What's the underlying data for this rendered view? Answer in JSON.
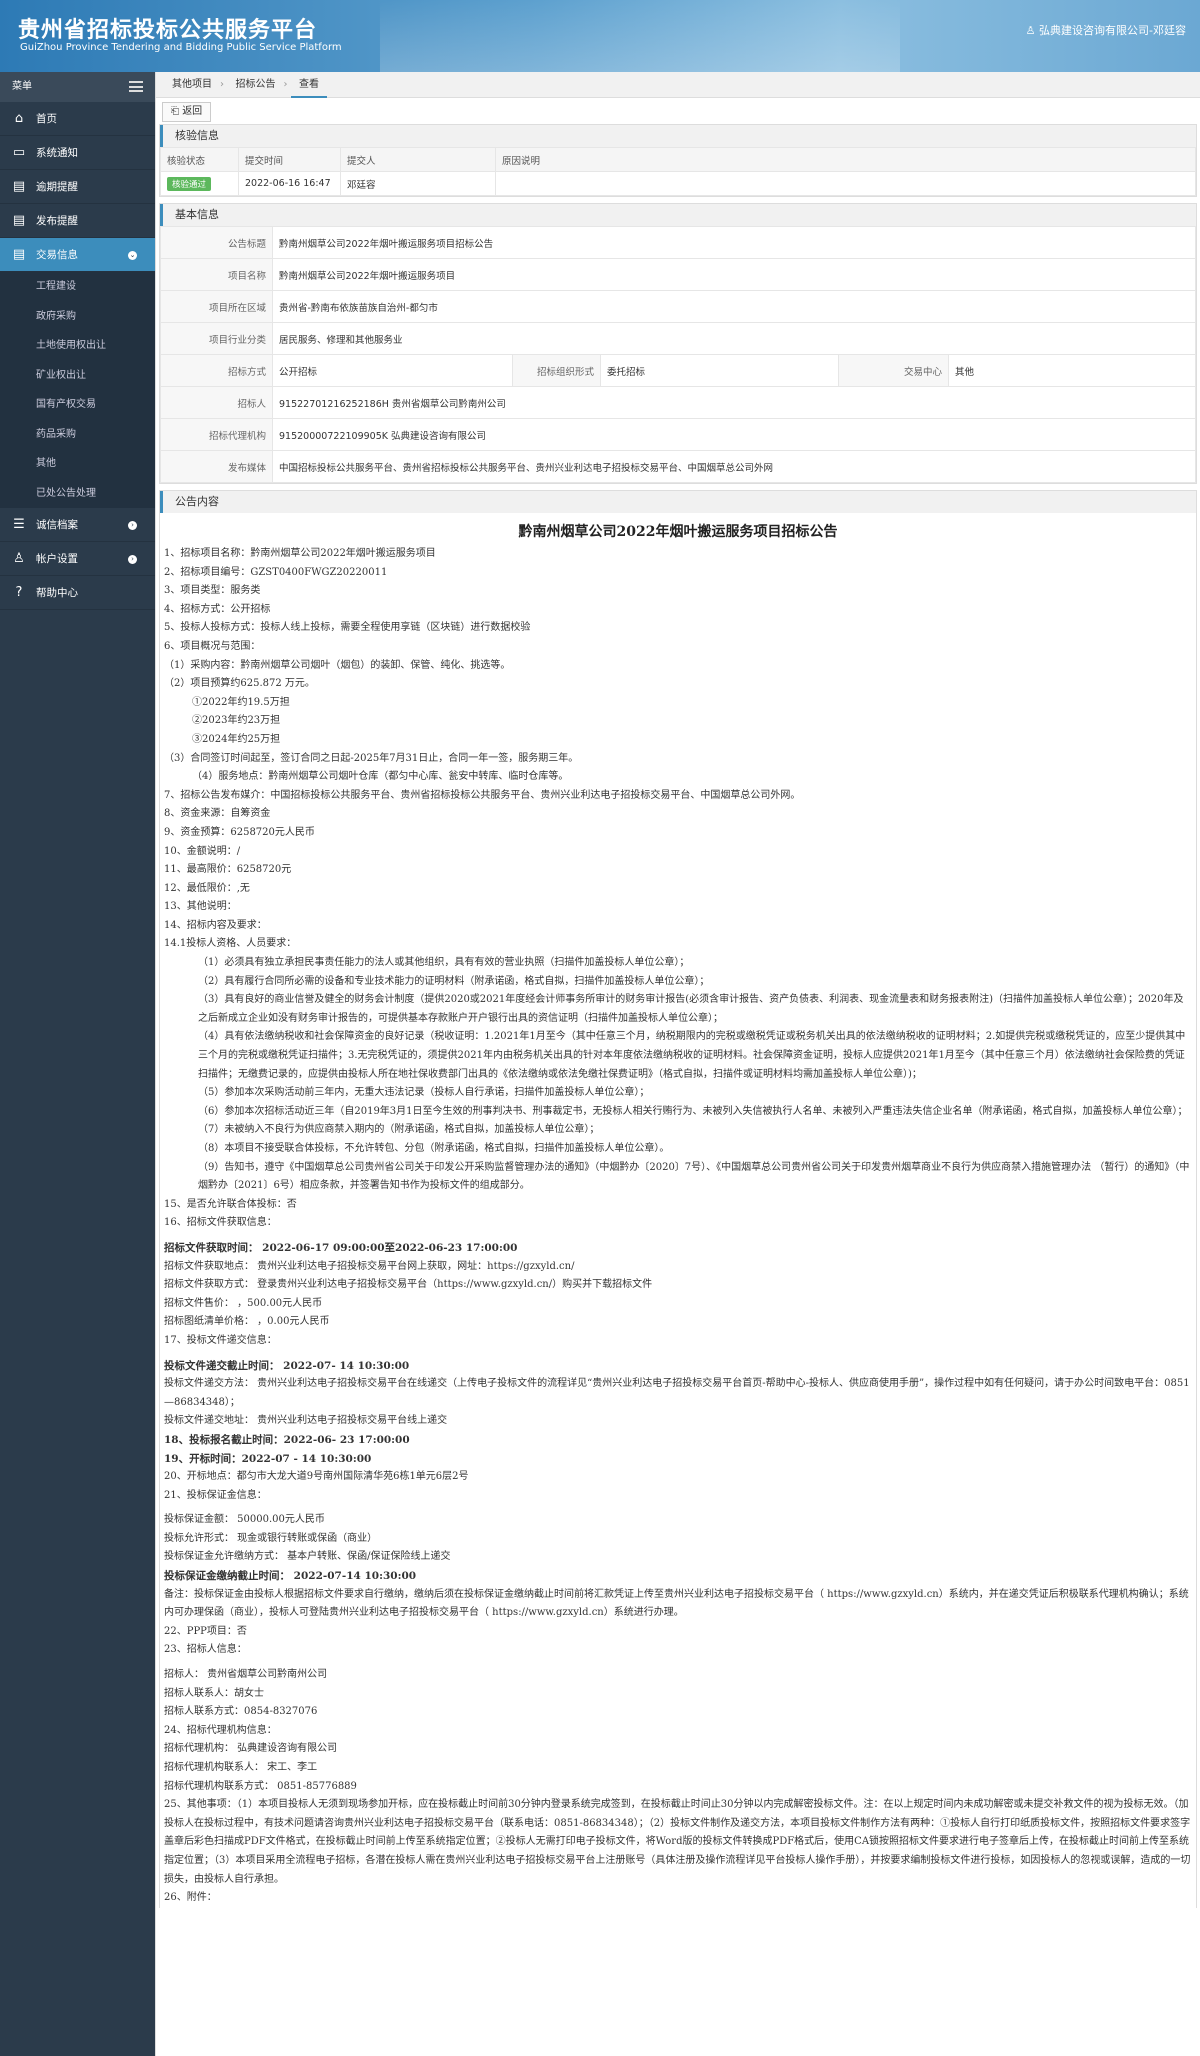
{
  "header": {
    "title": "贵州省招标投标公共服务平台",
    "subtitle": "GuiZhou Province Tendering and Bidding Public Service Platform",
    "user": "弘典建设咨询有限公司-邓廷容"
  },
  "sidebar": {
    "menu_label": "菜单",
    "items": [
      {
        "icon": "home-icon",
        "glyph": "⌂",
        "label": "首页"
      },
      {
        "icon": "monitor-icon",
        "glyph": "▭",
        "label": "系统通知"
      },
      {
        "icon": "calendar-icon",
        "glyph": "▤",
        "label": "逾期提醒"
      },
      {
        "icon": "calendar-icon",
        "glyph": "▤",
        "label": "发布提醒"
      },
      {
        "icon": "calendar-icon",
        "glyph": "▤",
        "label": "交易信息"
      }
    ],
    "subitems": [
      "工程建设",
      "政府采购",
      "土地使用权出让",
      "矿业权出让",
      "国有产权交易",
      "药品采购",
      "其他",
      "已处公告处理"
    ],
    "items2": [
      {
        "icon": "list-icon",
        "glyph": "☰",
        "label": "诚信档案"
      },
      {
        "icon": "user-icon",
        "glyph": "♙",
        "label": "帐户设置"
      },
      {
        "icon": "help-icon",
        "glyph": "?",
        "label": "帮助中心"
      }
    ]
  },
  "breadcrumb": [
    "其他项目",
    "招标公告",
    "查看"
  ],
  "toolbar": {
    "back": "返回"
  },
  "verify": {
    "title": "核验信息",
    "headers": [
      "核验状态",
      "提交时间",
      "提交人",
      "原因说明"
    ],
    "status": "核验通过",
    "time": "2022-06-16 16:47",
    "person": "邓廷容",
    "reason": ""
  },
  "basic": {
    "title": "基本信息",
    "rows": [
      {
        "label": "公告标题",
        "value": "黔南州烟草公司2022年烟叶搬运服务项目招标公告"
      },
      {
        "label": "项目名称",
        "value": "黔南州烟草公司2022年烟叶搬运服务项目"
      },
      {
        "label": "项目所在区域",
        "value": "贵州省-黔南布依族苗族自治州-都匀市"
      },
      {
        "label": "项目行业分类",
        "value": "居民服务、修理和其他服务业"
      }
    ],
    "method_label": "招标方式",
    "method": "公开招标",
    "org_label": "招标组织形式",
    "org": "委托招标",
    "center_label": "交易中心",
    "center": "其他",
    "rows2": [
      {
        "label": "招标人",
        "value": "91522701216252186H 贵州省烟草公司黔南州公司"
      },
      {
        "label": "招标代理机构",
        "value": "91520000722109905K 弘典建设咨询有限公司"
      },
      {
        "label": "发布媒体",
        "value": "中国招标投标公共服务平台、贵州省招标投标公共服务平台、贵州兴业利达电子招投标交易平台、中国烟草总公司外网"
      }
    ]
  },
  "notice": {
    "panel_title": "公告内容",
    "title": "黔南州烟草公司2022年烟叶搬运服务项目招标公告",
    "lines": [
      {
        "c": "",
        "t": "1、招标项目名称：黔南州烟草公司2022年烟叶搬运服务项目"
      },
      {
        "c": "",
        "t": "2、招标项目编号：GZST0400FWGZ20220011"
      },
      {
        "c": "",
        "t": "3、项目类型：服务类"
      },
      {
        "c": "",
        "t": "4、招标方式：公开招标"
      },
      {
        "c": "",
        "t": "5、投标人投标方式：投标人线上投标，需要全程使用享链（区块链）进行数据校验"
      },
      {
        "c": "",
        "t": "6、项目概况与范围："
      },
      {
        "c": "",
        "t": "（1）采购内容：黔南州烟草公司烟叶（烟包）的装卸、保管、纯化、挑选等。"
      },
      {
        "c": "",
        "t": "（2）项目预算约625.872 万元。"
      },
      {
        "c": "ind",
        "t": "①2022年约19.5万担"
      },
      {
        "c": "ind",
        "t": "②2023年约23万担"
      },
      {
        "c": "ind",
        "t": "③2024年约25万担"
      },
      {
        "c": "",
        "t": "（3）合同签订时间起至，签订合同之日起-2025年7月31日止，合同一年一签，服务期三年。"
      },
      {
        "c": "ind",
        "t": "（4）服务地点：黔南州烟草公司烟叶仓库（都匀中心库、瓮安中转库、临时仓库等。"
      },
      {
        "c": "",
        "t": "7、招标公告发布媒介：中国招标投标公共服务平台、贵州省招标投标公共服务平台、贵州兴业利达电子招投标交易平台、中国烟草总公司外网。"
      },
      {
        "c": "",
        "t": "8、资金来源：自筹资金"
      },
      {
        "c": "",
        "t": "9、资金预算：6258720元人民币"
      },
      {
        "c": "",
        "t": "10、金额说明：/"
      },
      {
        "c": "",
        "t": "11、最高限价：6258720元"
      },
      {
        "c": "",
        "t": "12、最低限价：,无"
      },
      {
        "c": "",
        "t": "13、其他说明："
      },
      {
        "c": "",
        "t": "14、招标内容及要求："
      },
      {
        "c": "",
        "t": "14.1投标人资格、人员要求："
      },
      {
        "c": "ind2",
        "t": "（1）必须具有独立承担民事责任能力的法人或其他组织，具有有效的营业执照（扫描件加盖投标人单位公章）；"
      },
      {
        "c": "ind2",
        "t": "（2）具有履行合同所必需的设备和专业技术能力的证明材料（附承诺函，格式自拟，扫描件加盖投标人单位公章）；"
      },
      {
        "c": "ind2",
        "t": "（3）具有良好的商业信誉及健全的财务会计制度（提供2020或2021年度经会计师事务所审计的财务审计报告(必须含审计报告、资产负债表、利润表、现金流量表和财务报表附注)（扫描件加盖投标人单位公章）；2020年及之后新成立企业如没有财务审计报告的，可提供基本存款账户开户银行出具的资信证明（扫描件加盖投标人单位公章）；"
      },
      {
        "c": "ind2",
        "t": "（4）具有依法缴纳税收和社会保障资金的良好记录（税收证明：1.2021年1月至今（其中任意三个月，纳税期限内的完税或缴税凭证或税务机关出具的依法缴纳税收的证明材料；2.如提供完税或缴税凭证的，应至少提供其中三个月的完税或缴税凭证扫描件；3.无完税凭证的，须提供2021年内由税务机关出具的针对本年度依法缴纳税收的证明材料。社会保障资金证明，投标人应提供2021年1月至今（其中任意三个月）依法缴纳社会保险费的凭证扫描件；无缴费记录的，应提供由投标人所在地社保收费部门出具的《依法缴纳或依法免缴社保费证明》（格式自拟，扫描件或证明材料均需加盖投标人单位公章）)；"
      },
      {
        "c": "ind2",
        "t": "（5）参加本次采购活动前三年内，无重大违法记录（投标人自行承诺，扫描件加盖投标人单位公章）；"
      },
      {
        "c": "ind2",
        "t": "（6）参加本次招标活动近三年（自2019年3月1日至今生效的刑事判决书、刑事裁定书，无投标人相关行贿行为、未被列入失信被执行人名单、未被列入严重违法失信企业名单（附承诺函，格式自拟，加盖投标人单位公章）；"
      },
      {
        "c": "ind2",
        "t": "（7）未被纳入不良行为供应商禁入期内的（附承诺函，格式自拟，加盖投标人单位公章）；"
      },
      {
        "c": "ind2",
        "t": "（8）本项目不接受联合体投标，不允许转包、分包（附承诺函，格式自拟，扫描件加盖投标人单位公章）。"
      },
      {
        "c": "ind2",
        "t": "（9）告知书，遵守《中国烟草总公司贵州省公司关于印发公开采购监督管理办法的通知》（中烟黔办〔2020〕7号）、《中国烟草总公司贵州省公司关于印发贵州烟草商业不良行为供应商禁入措施管理办法 （暂行）的通知》（中烟黔办〔2021〕6号）相应条款，并签署告知书作为投标文件的组成部分。"
      },
      {
        "c": "",
        "t": "15、是否允许联合体投标：否"
      },
      {
        "c": "",
        "t": "16、招标文件获取信息："
      },
      {
        "c": "gap",
        "t": ""
      },
      {
        "c": "b",
        "t": "招标文件获取时间：  2022-06-17  09:00:00至2022-06-23 17:00:00"
      },
      {
        "c": "",
        "t": "招标文件获取地点： 贵州兴业利达电子招投标交易平台网上获取，网址：https://gzxyld.cn/"
      },
      {
        "c": "",
        "t": "招标文件获取方式： 登录贵州兴业利达电子招投标交易平台（https://www.gzxyld.cn/）购买并下载招标文件"
      },
      {
        "c": "",
        "t": "招标文件售价： ，500.00元人民币"
      },
      {
        "c": "",
        "t": "招标图纸清单价格： ，0.00元人民币"
      },
      {
        "c": "",
        "t": "17、投标文件递交信息："
      },
      {
        "c": "gap",
        "t": ""
      },
      {
        "c": "b",
        "t": "投标文件递交截止时间： 2022-07- 14   10:30:00"
      },
      {
        "c": "",
        "t": "投标文件递交方法： 贵州兴业利达电子招投标交易平台在线递交（上传电子投标文件的流程详见“贵州兴业利达电子招投标交易平台首页-帮助中心-投标人、供应商使用手册”，操作过程中如有任何疑问，请于办公时间致电平台：0851—86834348）；"
      },
      {
        "c": "",
        "t": "投标文件递交地址： 贵州兴业利达电子招投标交易平台线上递交"
      },
      {
        "c": "b",
        "t": "18、投标报名截止时间：2022-06- 23     17:00:00"
      },
      {
        "c": "b",
        "t": "19、开标时间：2022-07 - 14    10:30:00"
      },
      {
        "c": "",
        "t": "20、开标地点：都匀市大龙大道9号南州国际清华苑6栋1单元6层2号"
      },
      {
        "c": "",
        "t": "21、投标保证金信息："
      },
      {
        "c": "gap",
        "t": ""
      },
      {
        "c": "",
        "t": "投标保证金额： 50000.00元人民币"
      },
      {
        "c": "",
        "t": "投标允许形式： 现金或银行转账或保函（商业）"
      },
      {
        "c": "",
        "t": "投标保证金允许缴纳方式： 基本户转账、保函/保证保险线上递交"
      },
      {
        "c": "b",
        "t": "投标保证金缴纳截止时间： 2022-07-14     10:30:00"
      },
      {
        "c": "",
        "t": "备注：投标保证金由投标人根据招标文件要求自行缴纳，缴纳后须在投标保证金缴纳截止时间前将汇款凭证上传至贵州兴业利达电子招投标交易平台（ https://www.gzxyld.cn）系统内，并在递交凭证后积极联系代理机构确认；系统内可办理保函（商业），投标人可登陆贵州兴业利达电子招投标交易平台（ https://www.gzxyld.cn）系统进行办理。"
      },
      {
        "c": "",
        "t": "22、PPP项目：否"
      },
      {
        "c": "",
        "t": "23、招标人信息："
      },
      {
        "c": "gap",
        "t": ""
      },
      {
        "c": "",
        "t": "招标人： 贵州省烟草公司黔南州公司"
      },
      {
        "c": "",
        "t": "招标人联系人：胡女士"
      },
      {
        "c": "",
        "t": "招标人联系方式：0854-8327076"
      },
      {
        "c": "",
        "t": "24、招标代理机构信息："
      },
      {
        "c": "",
        "t": "招标代理机构： 弘典建设咨询有限公司"
      },
      {
        "c": "",
        "t": "招标代理机构联系人： 宋工、李工"
      },
      {
        "c": "",
        "t": "招标代理机构联系方式： 0851-85776889"
      },
      {
        "c": "",
        "t": "25、其他事项：（1）本项目投标人无须到现场参加开标，应在投标截止时间前30分钟内登录系统完成签到，在投标截止时间止30分钟以内完成解密投标文件。注：在以上规定时间内未成功解密或未提交补救文件的视为投标无效。（加投标人在投标过程中，有技术问题请咨询贵州兴业利达电子招投标交易平台（联系电话：0851-86834348）；（2）投标文件制作及递交方法，本项目投标文件制作方法有两种：①投标人自行打印纸质投标文件，按照招标文件要求签字盖章后彩色扫描成PDF文件格式，在投标截止时间前上传至系统指定位置；②投标人无需打印电子投标文件，将Word版的投标文件转换成PDF格式后，使用CA锁按照招标文件要求进行电子签章后上传，在投标截止时间前上传至系统指定位置；（3）本项目采用全流程电子招标，各潜在投标人需在贵州兴业利达电子招投标交易平台上注册账号（具体注册及操作流程详见平台投标人操作手册），并按要求编制投标文件进行投标，如因投标人的忽视或误解，造成的一切损失，由投标人自行承担。"
      },
      {
        "c": "",
        "t": "26、附件："
      }
    ]
  }
}
